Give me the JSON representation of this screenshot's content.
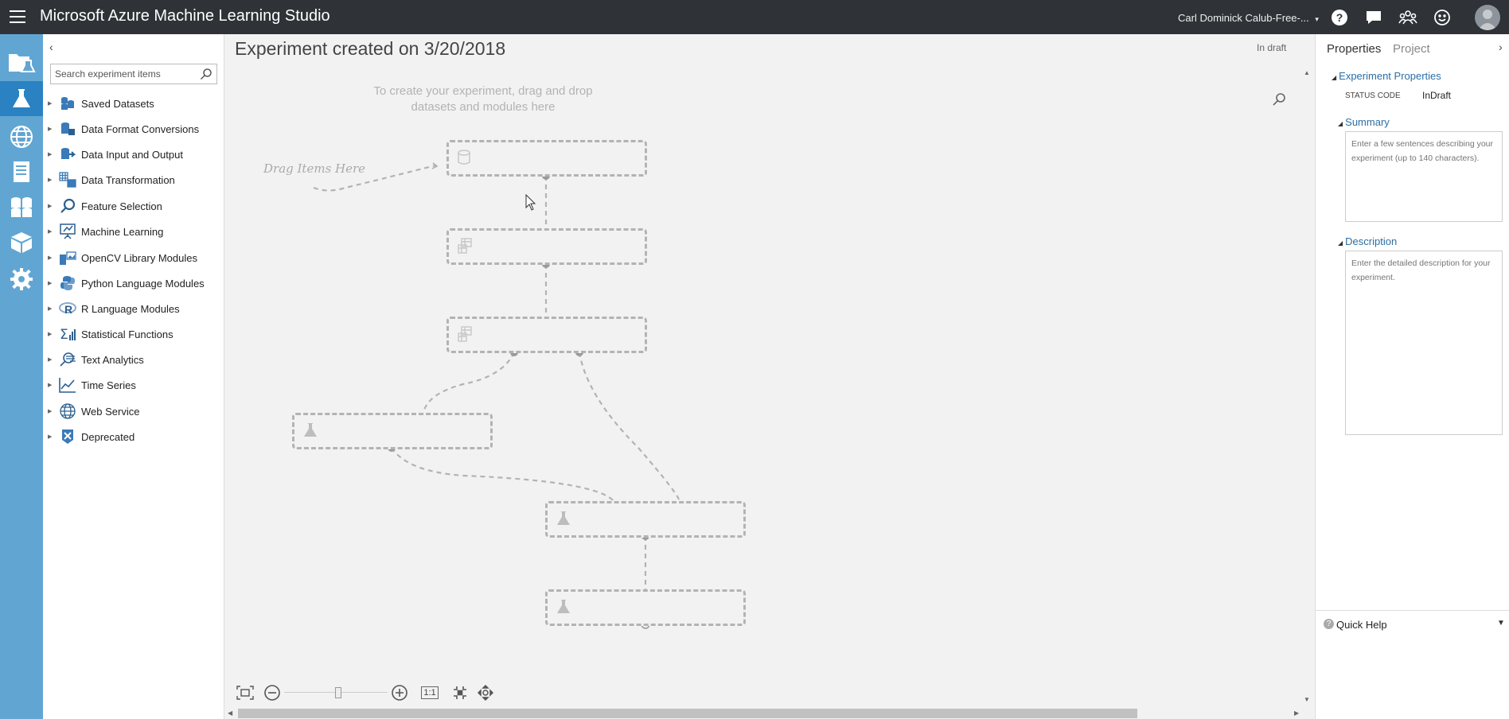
{
  "app": {
    "title": "Microsoft Azure Machine Learning Studio"
  },
  "user": {
    "name": "Carl Dominick Calub-Free-...",
    "dropdown": "▾"
  },
  "topbar_icons": [
    "help-icon",
    "feedback-icon",
    "community-icon",
    "smiley-icon",
    "avatar"
  ],
  "nav": [
    "projects-icon",
    "experiments-icon",
    "web-services-icon",
    "notebooks-icon",
    "datasets-icon",
    "trained-models-icon",
    "settings-icon"
  ],
  "palette": {
    "collapse_glyph": "‹",
    "search_placeholder": "Search experiment items",
    "categories": [
      {
        "label": "Saved Datasets",
        "icon": "dataset-icon"
      },
      {
        "label": "Data Format Conversions",
        "icon": "format-conversion-icon"
      },
      {
        "label": "Data Input and Output",
        "icon": "input-output-icon"
      },
      {
        "label": "Data Transformation",
        "icon": "transformation-icon"
      },
      {
        "label": "Feature Selection",
        "icon": "magnifier-icon"
      },
      {
        "label": "Machine Learning",
        "icon": "presentation-icon"
      },
      {
        "label": "OpenCV Library Modules",
        "icon": "opencv-icon"
      },
      {
        "label": "Python Language Modules",
        "icon": "python-icon"
      },
      {
        "label": "R Language Modules",
        "icon": "r-language-icon"
      },
      {
        "label": "Statistical Functions",
        "icon": "sigma-chart-icon"
      },
      {
        "label": "Text Analytics",
        "icon": "text-analytics-icon"
      },
      {
        "label": "Time Series",
        "icon": "time-series-icon"
      },
      {
        "label": "Web Service",
        "icon": "globe-icon"
      },
      {
        "label": "Deprecated",
        "icon": "deprecated-icon"
      }
    ]
  },
  "canvas": {
    "title": "Experiment created on 3/20/2018",
    "status": "In draft",
    "hint_line1": "To create your experiment, drag and drop",
    "hint_line2": "datasets and modules here",
    "drag_hint": "Drag Items Here",
    "zoom_ratio_label": "1:1"
  },
  "properties": {
    "tab_properties": "Properties",
    "tab_project": "Project",
    "collapse_glyph": "›",
    "section_experiment": "Experiment Properties",
    "status_code_key": "STATUS CODE",
    "status_code_value": "InDraft",
    "section_summary": "Summary",
    "summary_placeholder": "Enter a few sentences describing your experiment (up to 140 characters).",
    "section_description": "Description",
    "description_placeholder": "Enter the detailed description for your experiment.",
    "quick_help": "Quick Help",
    "quick_help_icon": "?"
  },
  "colors": {
    "topbar": "#2f3337",
    "nav_rail": "#61a6d3",
    "nav_active": "#2b82c2",
    "link_blue": "#2c6ea4"
  }
}
